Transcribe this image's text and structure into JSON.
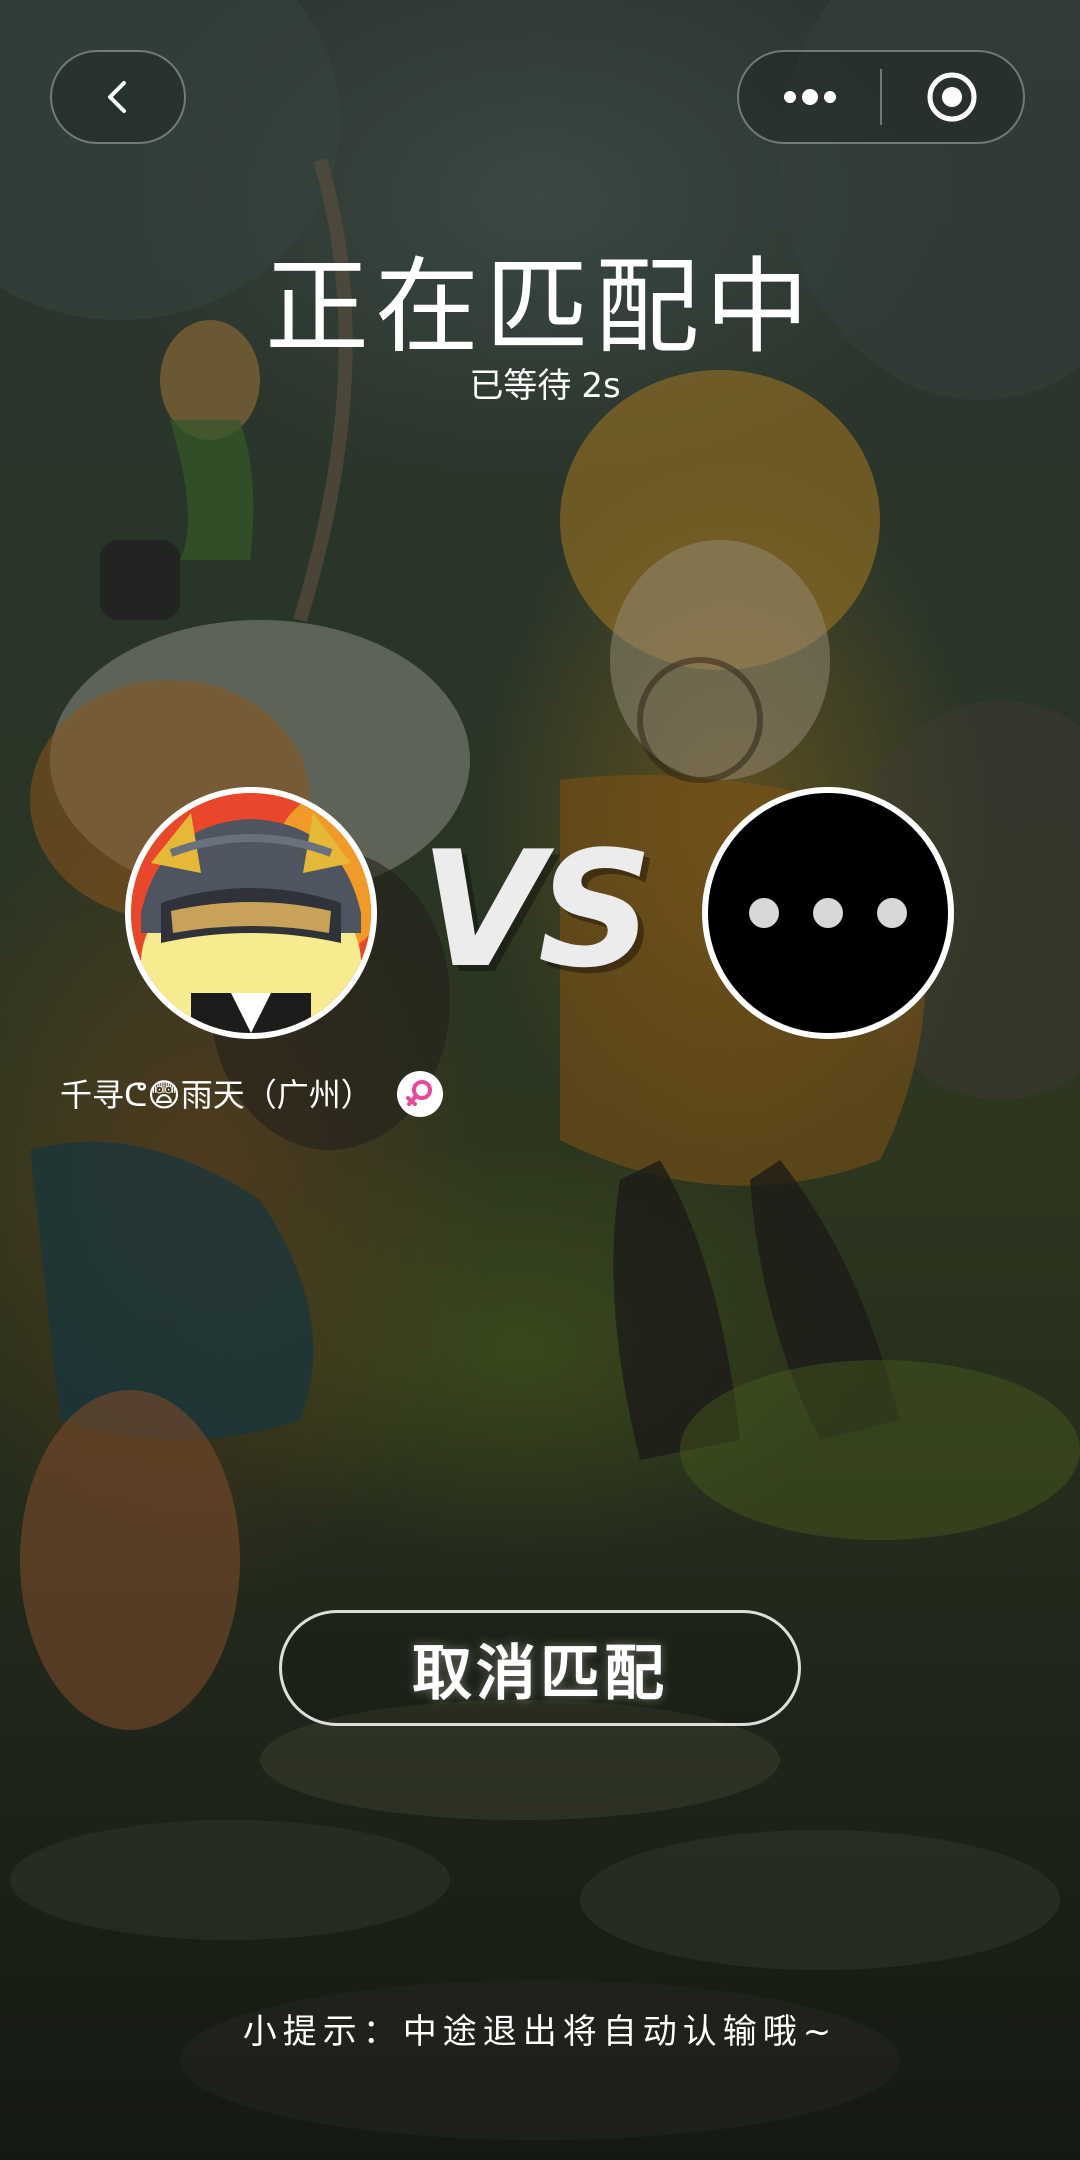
{
  "nav": {
    "back_icon": "chevron-left-icon",
    "more_icon": "more-dots-icon",
    "close_icon": "target-close-icon"
  },
  "match": {
    "title": "正在匹配中",
    "waited_label": "已等待",
    "waited_value": "2s"
  },
  "player": {
    "name": "千寻ᕦ😨雨天（广州）",
    "gender_icon": "female-icon",
    "gender_color": "#e8489a",
    "avatar_icon": "cartoon-helmet-dog-avatar"
  },
  "opponent": {
    "avatar_icon": "ellipsis-waiting-avatar"
  },
  "vs_label": "VS",
  "actions": {
    "cancel_label": "取消匹配"
  },
  "tip": "小提示：中途退出将自动认输哦~"
}
